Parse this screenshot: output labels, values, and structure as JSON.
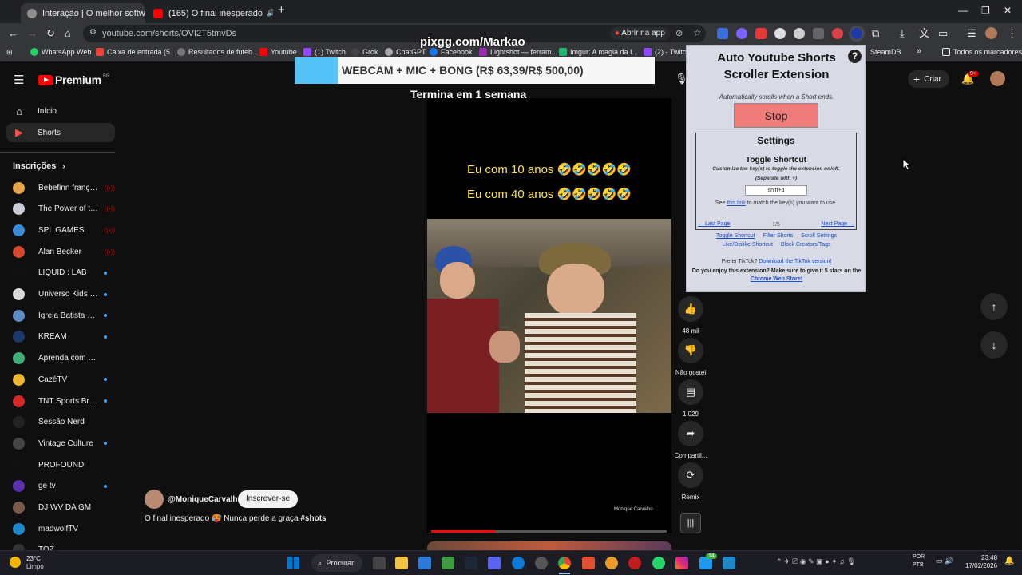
{
  "browser": {
    "tabs": [
      {
        "title": "Interação | O melhor software p",
        "active": true
      },
      {
        "title": "(165) O final inesperado",
        "active": false
      }
    ],
    "url": "youtube.com/shorts/OVI2T5tmvDs",
    "open_in_app": "Abrir na app",
    "bookmarks": [
      "WhatsApp Web",
      "Caixa de entrada (5...",
      "Resultados de futeb...",
      "Youtube",
      "(1) Twitch",
      "Grok",
      "ChatGPT",
      "Facebook",
      "Lightshot — ferram...",
      "Imgur: A magia da I...",
      "(2) - Twitch",
      "SteamDB"
    ],
    "all_bookmarks": "Todos os marcadores"
  },
  "watermark": "pixgg.com/Markao",
  "banner": {
    "text": "WEBCAM + MIC + BONG (R$ 63,39/R$ 500,00)",
    "subtext": "Termina em 1 semana"
  },
  "youtube": {
    "logo": "Premium",
    "logo_region": "BR",
    "create": "Criar",
    "notif_count": "9+",
    "nav": [
      {
        "label": "Início",
        "icon": "home-icon"
      },
      {
        "label": "Shorts",
        "icon": "shorts-icon"
      }
    ],
    "subs_title": "Inscrições",
    "subscriptions": [
      {
        "name": "Bebefinn françai...",
        "status": "live",
        "color": "#e8a44a"
      },
      {
        "name": "The Power of the...",
        "status": "live",
        "color": "#c9ccd6"
      },
      {
        "name": "SPL GAMES",
        "status": "live",
        "color": "#3a8bd6"
      },
      {
        "name": "Alan Becker",
        "status": "live",
        "color": "#d64a2b"
      },
      {
        "name": "LIQUID : LAB",
        "status": "new",
        "color": "#111111"
      },
      {
        "name": "Universo Kids - H...",
        "status": "new",
        "color": "#d8d8d8"
      },
      {
        "name": "Igreja Batista Ce...",
        "status": "new",
        "color": "#5b8fc4"
      },
      {
        "name": "KREAM",
        "status": "new",
        "color": "#1b3a6b"
      },
      {
        "name": "Aprenda com Luna!",
        "status": "none",
        "color": "#3fae77"
      },
      {
        "name": "CazéTV",
        "status": "new",
        "color": "#f2b632"
      },
      {
        "name": "TNT Sports Brasil",
        "status": "new",
        "color": "#d62828"
      },
      {
        "name": "Sessão Nerd",
        "status": "none",
        "color": "#222222"
      },
      {
        "name": "Vintage Culture",
        "status": "new",
        "color": "#444444"
      },
      {
        "name": "PROFOUND",
        "status": "none",
        "color": "#111111"
      },
      {
        "name": "ge tv",
        "status": "new",
        "color": "#5a2fb0"
      },
      {
        "name": "DJ WV DA GM",
        "status": "none",
        "color": "#7a5b4a"
      },
      {
        "name": "madwolfTV",
        "status": "none",
        "color": "#1e88c9"
      },
      {
        "name": "TOZ",
        "status": "none",
        "color": "#333333"
      }
    ],
    "video": {
      "caption1": "Eu com 10 anos 🤣🤣🤣🤣🤣",
      "caption2": "Eu com 40 anos 🤣🤣🤣🤣🤣",
      "watermark": "Monique Carvalho",
      "progress": 0.27
    },
    "channel": "@MoniqueCarvalho",
    "subscribe": "Inscrever-se",
    "title": "O final inesperado",
    "title_tag": "Nunca perde a graça",
    "hashtag": "#shots",
    "actions": [
      {
        "label": "48 mil",
        "icon": "thumbs-up-icon"
      },
      {
        "label": "Não gostei",
        "icon": "thumbs-down-icon"
      },
      {
        "label": "1.029",
        "icon": "comment-icon"
      },
      {
        "label": "Compartil...",
        "icon": "share-icon"
      },
      {
        "label": "Remix",
        "icon": "remix-icon"
      }
    ]
  },
  "extension": {
    "title": "Auto Youtube Shorts Scroller Extension",
    "subtitle": "Automatically scrolls when a Short ends.",
    "stop": "Stop",
    "settings_title": "Settings",
    "section_title": "Toggle Shortcut",
    "section_desc": "Customize the key(s) to toggle the extension on/off.",
    "separate": "(Seperate with +)",
    "shortcut_value": "shift+d",
    "see": "See",
    "this_link": "this link",
    "see_rest": "to match the key(s) you want to use.",
    "last_page": "← Last Page",
    "page": "1/5",
    "next_page": "Next Page →",
    "tabs_row1": [
      "Toggle Shortcut",
      "Filter Shorts",
      "Scroll Settings"
    ],
    "tabs_row2": [
      "Like/Dislike Shortcut",
      "Block Creators/Tags"
    ],
    "prefer": "Prefer TikTok?",
    "download": "Download the TikTok version!",
    "enjoy": "Do you enjoy this extension? Make sure to give it 5 stars on the",
    "store": "Chrome Web Store!"
  },
  "taskbar": {
    "temp": "23°C",
    "weather": "Limpo",
    "search": "Procurar",
    "lang1": "POR",
    "lang2": "PTB",
    "time": "23:48",
    "date": "17/02/2026",
    "badge": "14"
  }
}
